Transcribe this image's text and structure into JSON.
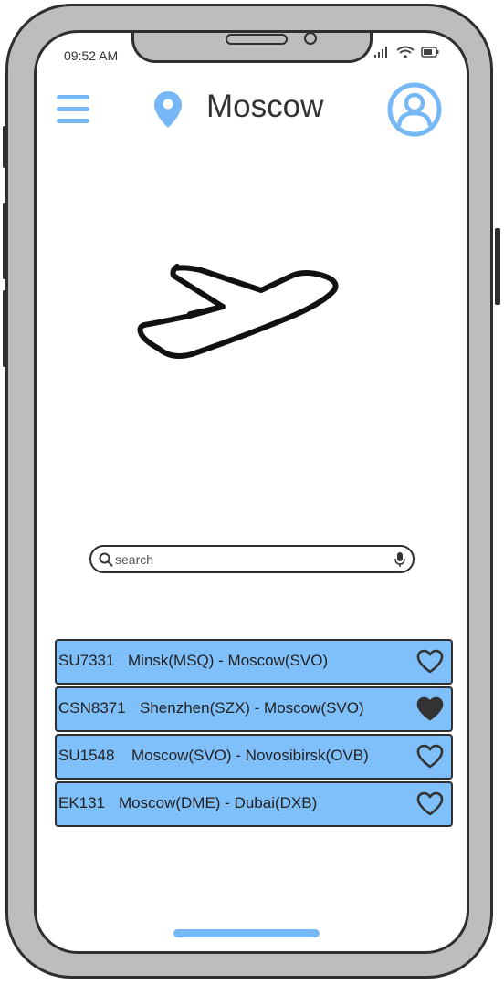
{
  "status_bar": {
    "time": "09:52 AM"
  },
  "header": {
    "city": "Moscow",
    "menu_icon": "hamburger-menu-icon",
    "location_icon": "map-pin-icon",
    "profile_icon": "user-avatar-icon",
    "accent_color": "#76b8f5"
  },
  "hero": {
    "icon": "airplane-takeoff-icon"
  },
  "search": {
    "placeholder": "search",
    "value": ""
  },
  "flights": [
    {
      "code": "SU7331",
      "route": "Minsk(MSQ) - Moscow(SVO)",
      "favorite": false
    },
    {
      "code": "CSN8371",
      "route": "Shenzhen(SZX) - Moscow(SVO)",
      "favorite": true
    },
    {
      "code": "SU1548",
      "route": "Moscow(SVO) - Novosibirsk(OVB)",
      "favorite": false
    },
    {
      "code": "EK131",
      "route": "Moscow(DME) - Dubai(DXB)",
      "favorite": false
    }
  ],
  "colors": {
    "list_item_bg": "#7fbffa",
    "frame": "#bdbdbd",
    "outline": "#2f2f2f"
  }
}
